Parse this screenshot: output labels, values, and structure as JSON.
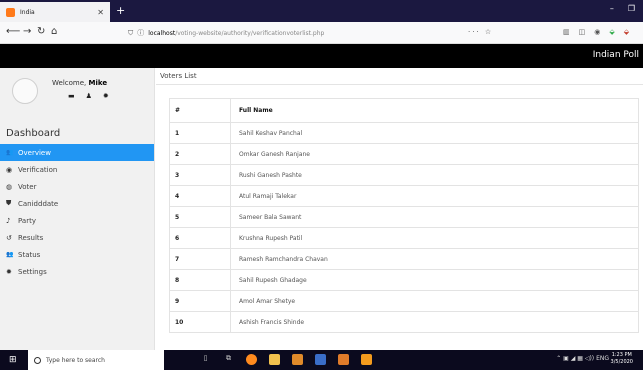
{
  "browser": {
    "tab_title": "India",
    "url_host": "localhost",
    "url_path": "/voting-website/authority/verificationvoterlist.php",
    "url_more": "··· ☆"
  },
  "app": {
    "brand": "Indian Poll",
    "welcome_prefix": "Welcome,",
    "user_name": "Mike",
    "dashboard_label": "Dashboard"
  },
  "sidebar": {
    "items": [
      {
        "label": "Overview",
        "icon": "users-icon",
        "active": true
      },
      {
        "label": "Verification",
        "icon": "eye-icon",
        "active": false
      },
      {
        "label": "Voter",
        "icon": "circle-icon",
        "active": false
      },
      {
        "label": "Canidddate",
        "icon": "shield-icon",
        "active": false
      },
      {
        "label": "Party",
        "icon": "bell-icon",
        "active": false
      },
      {
        "label": "Results",
        "icon": "history-icon",
        "active": false
      },
      {
        "label": "Status",
        "icon": "users-icon",
        "active": false
      },
      {
        "label": "Settings",
        "icon": "gear-icon",
        "active": false
      }
    ]
  },
  "content": {
    "title": "Voters List",
    "columns": [
      "#",
      "Full Name"
    ],
    "rows": [
      [
        "1",
        "Sahil Keshav Panchal"
      ],
      [
        "2",
        "Omkar Ganesh Ranjane"
      ],
      [
        "3",
        "Rushi Ganesh Pashte"
      ],
      [
        "4",
        "Atul Ramaji Talekar"
      ],
      [
        "5",
        "Sameer Bala Sawant"
      ],
      [
        "6",
        "Krushna Rupesh Patil"
      ],
      [
        "7",
        "Ramesh Ramchandra Chavan"
      ],
      [
        "8",
        "Sahil Rupesh Ghadage"
      ],
      [
        "9",
        "Amol Amar Shetye"
      ],
      [
        "10",
        "Ashish Francis Shinde"
      ]
    ]
  },
  "taskbar": {
    "search_placeholder": "Type here to search",
    "lang": "ENG",
    "time": "1:23 PM",
    "date": "3/5/2020"
  },
  "colors": {
    "accent": "#2196f3",
    "header": "#000000",
    "browser_dark": "#1b1840"
  }
}
